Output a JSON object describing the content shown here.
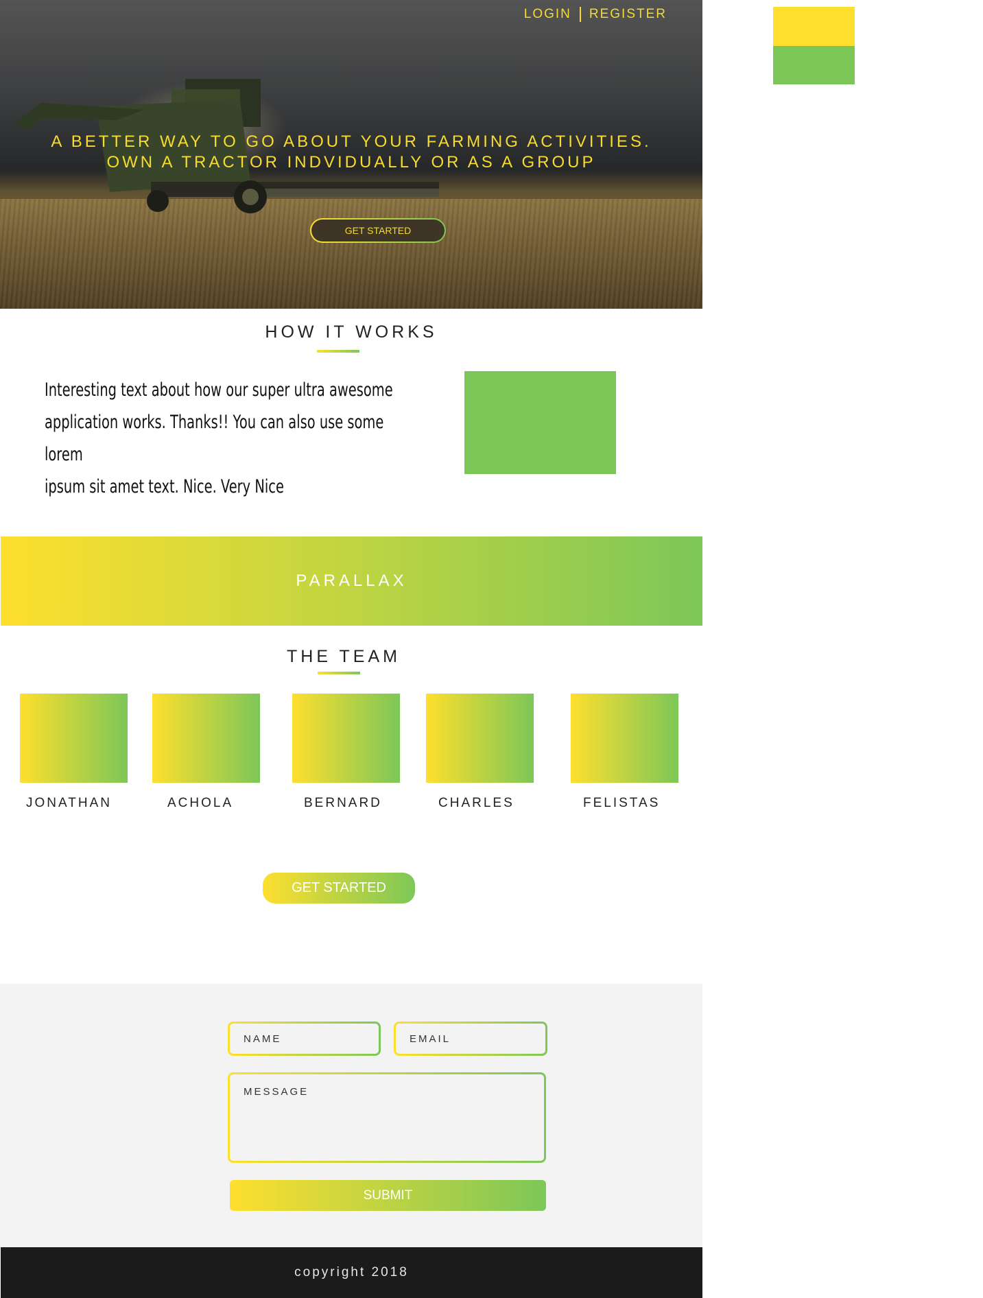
{
  "nav": {
    "login": "LOGIN",
    "register": "REGISTER"
  },
  "hero": {
    "title_line1": "A BETTER WAY TO GO ABOUT YOUR FARMING ACTIVITIES.",
    "title_line2": "OWN A TRACTOR INDVIDUALLY OR AS A GROUP",
    "button": "GET STARTED"
  },
  "swatches": {
    "primary": "#fedf2e",
    "secondary": "#7dc758"
  },
  "how_it_works": {
    "title": "HOW IT WORKS",
    "text_line1": "Interesting text about how our super ultra awesome",
    "text_line2": "application works. Thanks!! You can also use some lorem",
    "text_line3": "ipsum sit amet text. Nice. Very Nice"
  },
  "parallax": {
    "label": "PARALLAX"
  },
  "team": {
    "title": "THE TEAM",
    "members": [
      "JONATHAN",
      "ACHOLA",
      "BERNARD",
      "CHARLES",
      "FELISTAS"
    ]
  },
  "cta": {
    "label": "GET STARTED"
  },
  "contact": {
    "name_placeholder": "NAME",
    "email_placeholder": "EMAIL",
    "message_placeholder": "MESSAGE",
    "submit": "SUBMIT"
  },
  "footer": {
    "copyright": "copyright 2018"
  }
}
